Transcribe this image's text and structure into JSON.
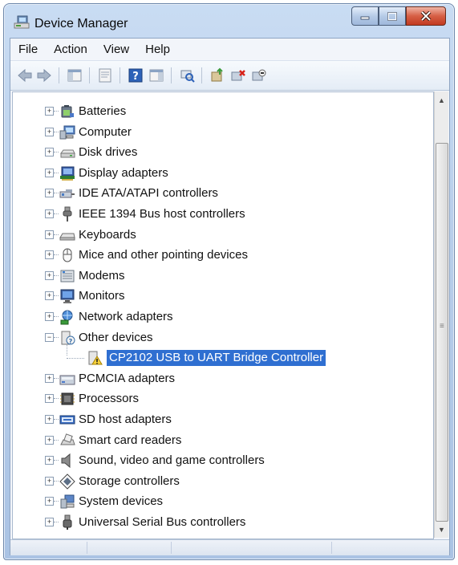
{
  "window": {
    "title": "Device Manager"
  },
  "menubar": {
    "items": [
      "File",
      "Action",
      "View",
      "Help"
    ]
  },
  "toolbar": {
    "buttons": [
      "back-arrow-icon",
      "forward-arrow-icon",
      "show-hide-console-tree-icon",
      "properties-icon",
      "help-icon",
      "show-action-pane-icon",
      "scan-hardware-icon",
      "update-driver-icon",
      "uninstall-icon",
      "disable-device-icon"
    ]
  },
  "tree": {
    "nodes": [
      {
        "label": "Batteries",
        "icon": "battery-icon",
        "expanded": false
      },
      {
        "label": "Computer",
        "icon": "computer-icon",
        "expanded": false
      },
      {
        "label": "Disk drives",
        "icon": "disk-drive-icon",
        "expanded": false
      },
      {
        "label": "Display adapters",
        "icon": "display-adapter-icon",
        "expanded": false
      },
      {
        "label": "IDE ATA/ATAPI controllers",
        "icon": "ide-controller-icon",
        "expanded": false
      },
      {
        "label": "IEEE 1394 Bus host controllers",
        "icon": "ieee1394-icon",
        "expanded": false
      },
      {
        "label": "Keyboards",
        "icon": "keyboard-icon",
        "expanded": false
      },
      {
        "label": "Mice and other pointing devices",
        "icon": "mouse-icon",
        "expanded": false
      },
      {
        "label": "Modems",
        "icon": "modem-icon",
        "expanded": false
      },
      {
        "label": "Monitors",
        "icon": "monitor-icon",
        "expanded": false
      },
      {
        "label": "Network adapters",
        "icon": "network-adapter-icon",
        "expanded": false
      },
      {
        "label": "Other devices",
        "icon": "unknown-device-icon",
        "expanded": true,
        "children": [
          {
            "label": "CP2102 USB to UART Bridge Controller",
            "icon": "warning-device-icon",
            "selected": true
          }
        ]
      },
      {
        "label": "PCMCIA adapters",
        "icon": "pcmcia-icon",
        "expanded": false
      },
      {
        "label": "Processors",
        "icon": "processor-icon",
        "expanded": false
      },
      {
        "label": "SD host adapters",
        "icon": "sd-host-icon",
        "expanded": false
      },
      {
        "label": "Smart card readers",
        "icon": "smart-card-reader-icon",
        "expanded": false
      },
      {
        "label": "Sound, video and game controllers",
        "icon": "speaker-icon",
        "expanded": false
      },
      {
        "label": "Storage controllers",
        "icon": "storage-controller-icon",
        "expanded": false
      },
      {
        "label": "System devices",
        "icon": "system-devices-icon",
        "expanded": false
      },
      {
        "label": "Universal Serial Bus controllers",
        "icon": "usb-icon",
        "expanded": false
      }
    ]
  },
  "colors": {
    "selection": "#2f6fd1",
    "window_frame": "#b9cfeb"
  }
}
